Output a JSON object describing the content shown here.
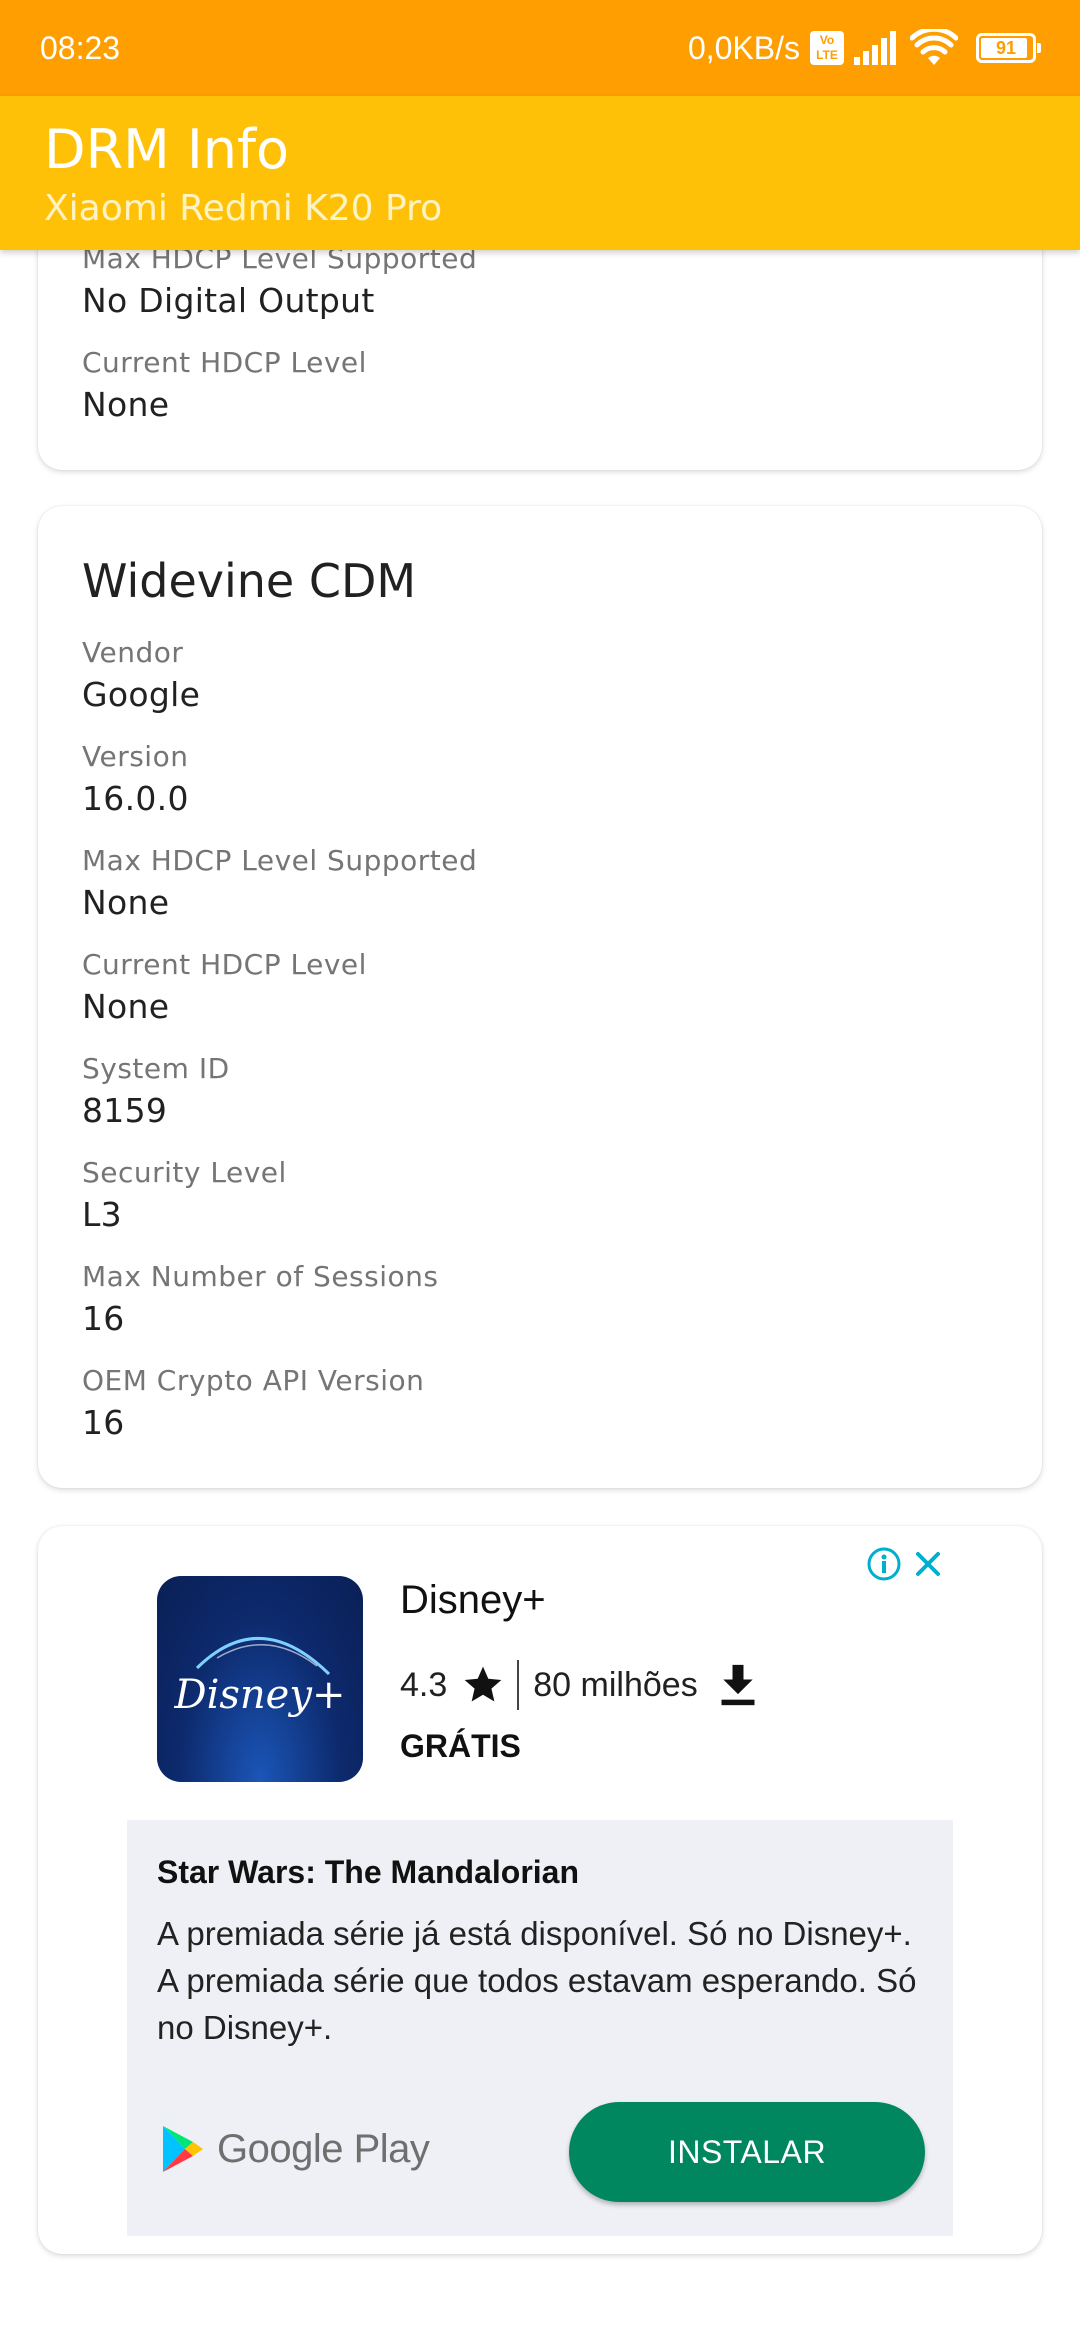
{
  "status_bar": {
    "time": "08:23",
    "network_speed": "0,0KB/s",
    "volte_top": "Vo",
    "volte_bottom": "LTE",
    "battery": "91"
  },
  "app_bar": {
    "title": "DRM Info",
    "subtitle": "Xiaomi Redmi K20 Pro",
    "background": "#ffc107",
    "status_background": "#ff9e00"
  },
  "prev_card": {
    "fields": [
      {
        "label": "Max HDCP Level Supported",
        "value": "No Digital Output"
      },
      {
        "label": "Current HDCP Level",
        "value": "None"
      }
    ]
  },
  "widevine_card": {
    "title": "Widevine CDM",
    "fields": [
      {
        "label": "Vendor",
        "value": "Google"
      },
      {
        "label": "Version",
        "value": "16.0.0"
      },
      {
        "label": "Max HDCP Level Supported",
        "value": "None"
      },
      {
        "label": "Current HDCP Level",
        "value": "None"
      },
      {
        "label": "System ID",
        "value": "8159"
      },
      {
        "label": "Security Level",
        "value": "L3"
      },
      {
        "label": "Max Number of Sessions",
        "value": "16"
      },
      {
        "label": "OEM Crypto API Version",
        "value": "16"
      }
    ]
  },
  "ad": {
    "app_name": "Disney+",
    "icon_wordmark": "Disney+",
    "rating": "4.3",
    "downloads": "80 milhões",
    "price": "GRÁTIS",
    "headline": "Star Wars: The Mandalorian",
    "body": "A premiada série já está disponível. Só no Disney+. A premiada série que todos estavam esperando. Só no Disney+.",
    "store_label": "Google Play",
    "install_label": "INSTALAR",
    "install_color": "#01875f",
    "adchoices_color": "#00aecd"
  }
}
